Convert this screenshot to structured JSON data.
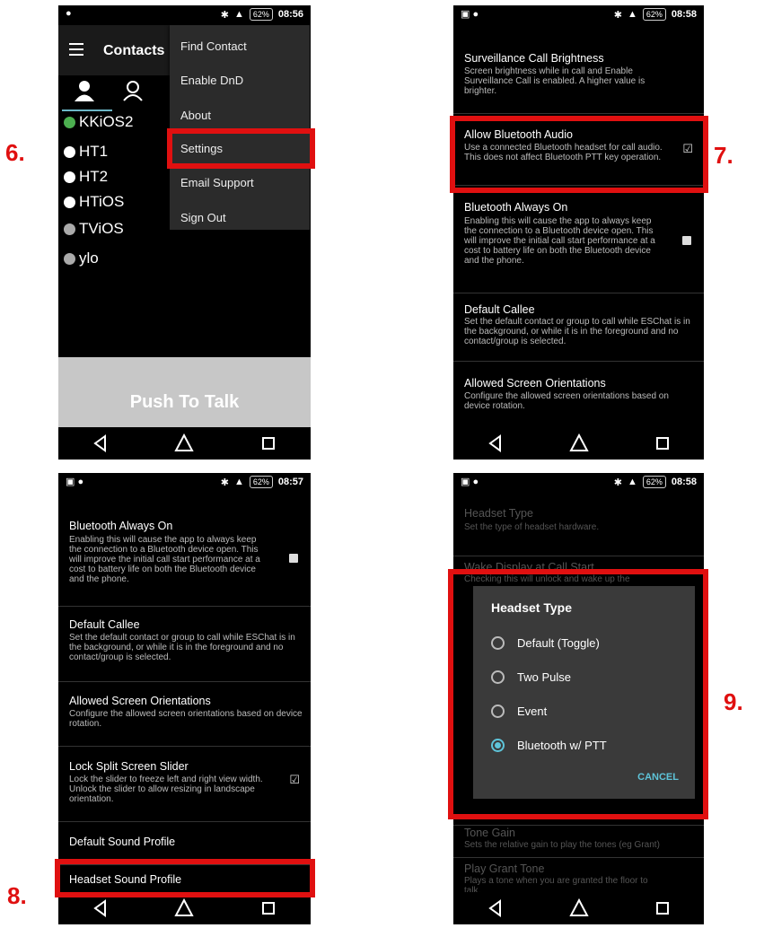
{
  "steps": [
    "6.",
    "7.",
    "8.",
    "9."
  ],
  "nav_icons": [
    "back-icon",
    "home-icon",
    "recents-icon"
  ],
  "panel1": {
    "status_time": "08:56",
    "battery": "62%",
    "title": "Contacts",
    "contacts": [
      {
        "name": "KKiOS2",
        "status": "online",
        "color": "#4caf50"
      },
      {
        "name": "HT1",
        "status": "dnd",
        "color": "#ffffff"
      },
      {
        "name": "HT2",
        "status": "dnd",
        "color": "#ffffff"
      },
      {
        "name": "HTiOS",
        "status": "dnd",
        "color": "#ffffff"
      },
      {
        "name": "TViOS",
        "status": "offline",
        "color": "#aaaaaa"
      },
      {
        "name": "ylo",
        "status": "offline",
        "color": "#aaaaaa"
      }
    ],
    "menu": [
      "Find Contact",
      "Enable DnD",
      "About",
      "Settings",
      "Email Support",
      "Sign Out"
    ],
    "ptt_label": "Push To Talk"
  },
  "panel2": {
    "status_time": "08:58",
    "battery": "62%",
    "prefs": [
      {
        "title": "Surveillance Call Brightness",
        "summary": "Screen brightness while in call and Enable Surveillance Call is enabled. A higher value is brighter.",
        "checkbox": "none"
      },
      {
        "title": "Allow Bluetooth Audio",
        "summary": "Use a connected Bluetooth headset for call audio. This does not affect Bluetooth PTT key operation.",
        "checkbox": "checked"
      },
      {
        "title": "Bluetooth Always On",
        "summary": "Enabling this will cause the app to always keep the connection to a Bluetooth device open. This will improve the initial call start performance at a cost to battery life on both the Bluetooth device and the phone.",
        "checkbox": "unchecked"
      },
      {
        "title": "Default Callee",
        "summary": "Set the default contact or group to call while ESChat is in the background, or while it is in the foreground and no contact/group is selected.",
        "checkbox": "none"
      },
      {
        "title": "Allowed Screen Orientations",
        "summary": "Configure the allowed screen orientations based on device rotation.",
        "checkbox": "none"
      }
    ]
  },
  "panel3": {
    "status_time": "08:57",
    "battery": "62%",
    "prefs": [
      {
        "title": "Bluetooth Always On",
        "summary": "Enabling this will cause the app to always keep the connection to a Bluetooth device open. This will improve the initial call start performance at a cost to battery life on both the Bluetooth device and the phone.",
        "checkbox": "unchecked"
      },
      {
        "title": "Default Callee",
        "summary": "Set the default contact or group to call while ESChat is in the background, or while it is in the foreground and no contact/group is selected.",
        "checkbox": "none"
      },
      {
        "title": "Allowed Screen Orientations",
        "summary": "Configure the allowed screen orientations based on device rotation.",
        "checkbox": "none"
      },
      {
        "title": "Lock Split Screen Slider",
        "summary": "Lock the slider to freeze left and right view width. Unlock the slider to allow resizing in landscape orientation.",
        "checkbox": "checked"
      },
      {
        "title": "Default Sound Profile",
        "summary": "",
        "checkbox": "none"
      },
      {
        "title": "Headset Sound Profile",
        "summary": "",
        "checkbox": "none"
      }
    ]
  },
  "panel4": {
    "status_time": "08:58",
    "battery": "62%",
    "bg_prefs": [
      {
        "title": "Headset Type",
        "summary": "Set the type of headset hardware."
      },
      {
        "title": "Wake Display at Call Start",
        "summary": "Checking this will unlock and wake up the"
      },
      {
        "title": "Tone Gain",
        "summary": "Sets the relative gain to play the tones (eg Grant)"
      },
      {
        "title": "Play Grant Tone",
        "summary": "Plays a tone when you are granted the floor to talk."
      }
    ],
    "dialog": {
      "title": "Headset Type",
      "options": [
        "Default (Toggle)",
        "Two Pulse",
        "Event",
        "Bluetooth w/ PTT"
      ],
      "selected": "Bluetooth w/ PTT",
      "cancel": "CANCEL"
    }
  }
}
